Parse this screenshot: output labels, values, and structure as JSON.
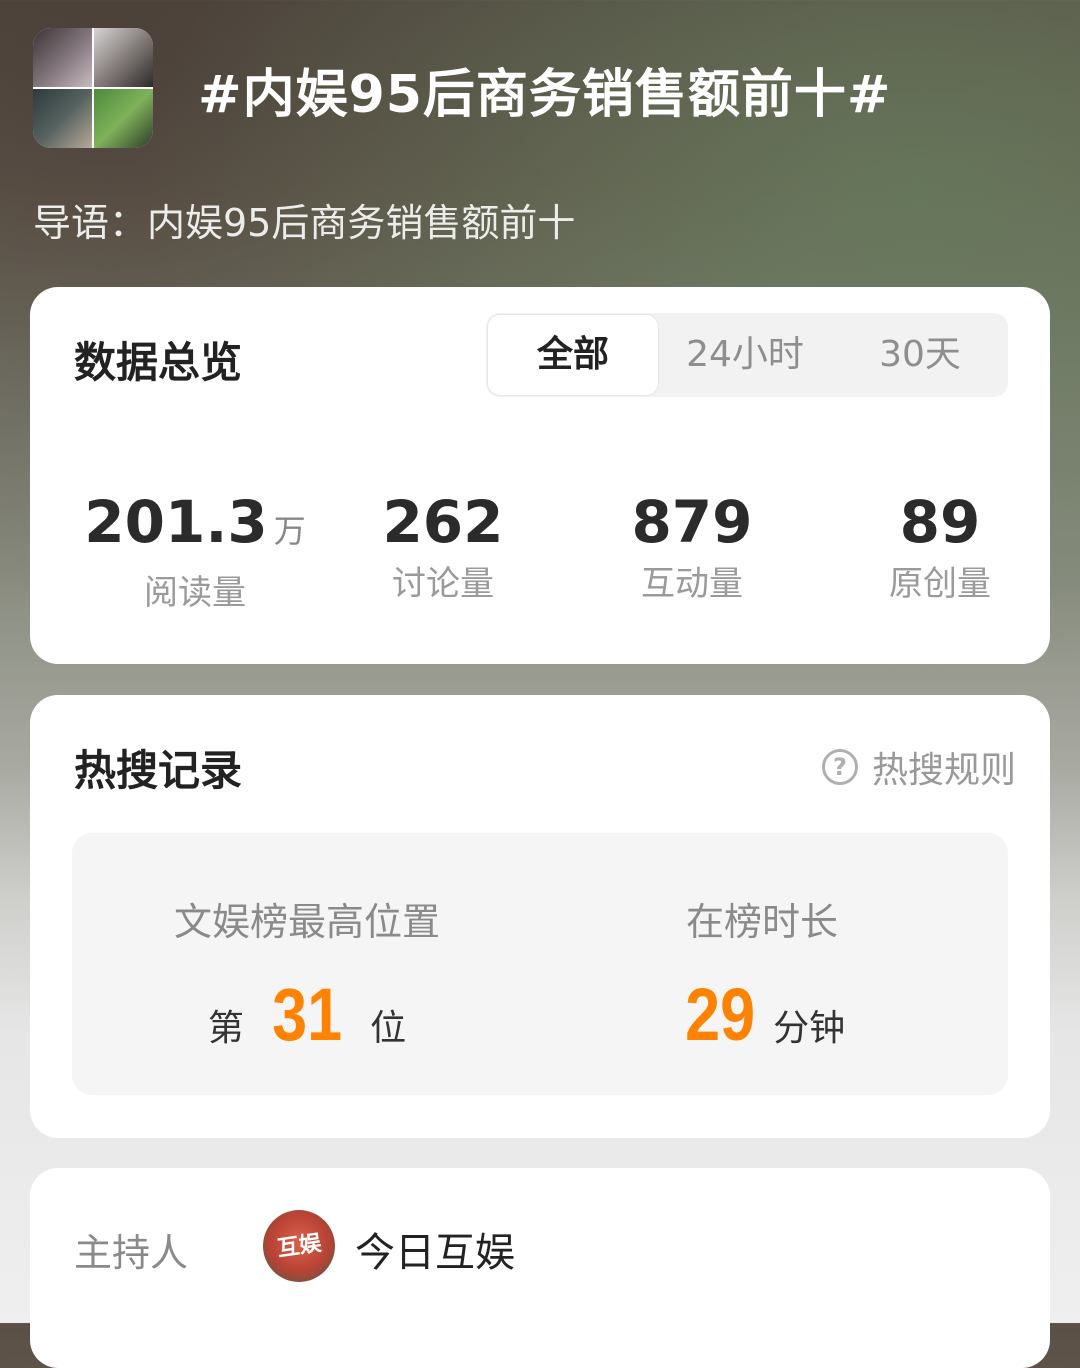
{
  "header": {
    "title": "#内娱95后商务销售额前十#",
    "intro": "导语：内娱95后商务销售额前十"
  },
  "overview": {
    "heading": "数据总览",
    "tabs": [
      {
        "label": "全部",
        "active": true
      },
      {
        "label": "24小时",
        "active": false
      },
      {
        "label": "30天",
        "active": false
      }
    ],
    "stats": [
      {
        "value": "201.3",
        "unit": "万",
        "label": "阅读量"
      },
      {
        "value": "262",
        "unit": "",
        "label": "讨论量"
      },
      {
        "value": "879",
        "unit": "",
        "label": "互动量"
      },
      {
        "value": "89",
        "unit": "",
        "label": "原创量"
      }
    ]
  },
  "hot_search": {
    "heading": "热搜记录",
    "rule_link": "热搜规则",
    "rule_icon": "question-circle-icon",
    "rank": {
      "label": "文娱榜最高位置",
      "prefix": "第",
      "value": "31",
      "suffix": "位"
    },
    "duration": {
      "label": "在榜时长",
      "value": "29",
      "suffix": "分钟"
    },
    "accent_color": "#ff8200"
  },
  "host": {
    "label": "主持人",
    "name": "今日互娱"
  }
}
